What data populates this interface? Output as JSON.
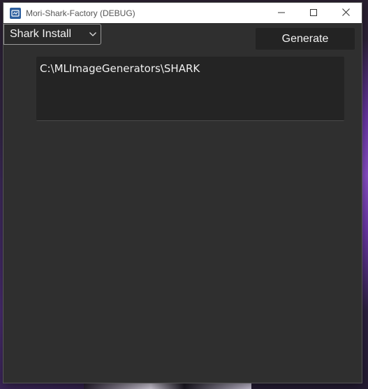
{
  "window": {
    "title": "Mori-Shark-Factory (DEBUG)",
    "icon": "app-icon",
    "controls": {
      "minimize_icon": "minimize-icon",
      "maximize_icon": "maximize-icon",
      "close_icon": "close-icon"
    }
  },
  "toolbar": {
    "install_select": {
      "selected": "Shark Install",
      "icon": "chevron-down-icon"
    },
    "generate_label": "Generate"
  },
  "main": {
    "path_text": "C:\\MLImageGenerators\\SHARK"
  },
  "colors": {
    "window_bg": "#2f2f2f",
    "button_bg": "#232323",
    "field_bg": "#242424",
    "text": "#f2f2f2",
    "titlebar": "#ffffff"
  }
}
